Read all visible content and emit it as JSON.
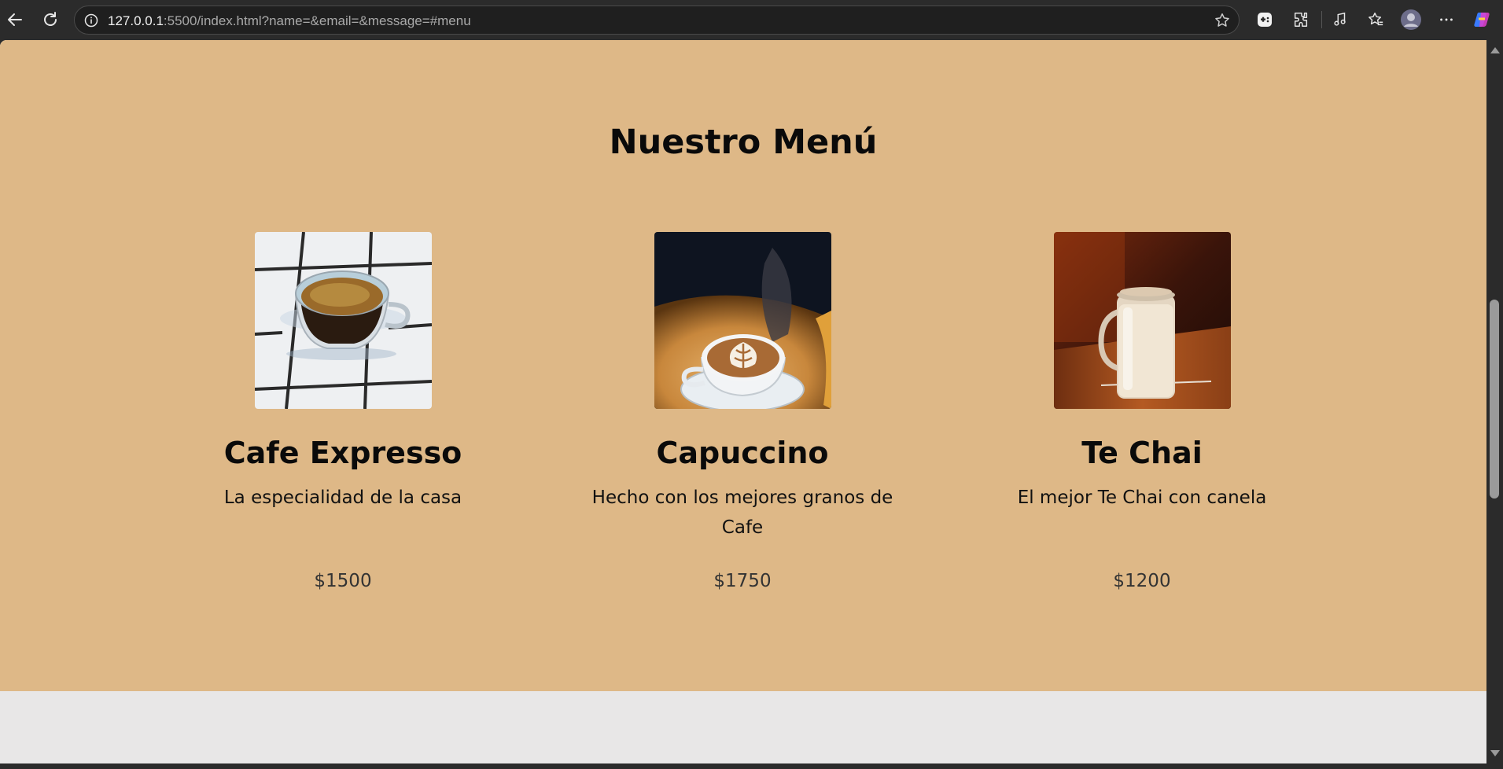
{
  "browser": {
    "url_host": "127.0.0.1",
    "url_rest": ":5500/index.html?name=&email=&message=#menu",
    "icons": {
      "back": "back-arrow-icon",
      "reload": "reload-icon",
      "info": "info-icon",
      "favorite": "star-icon",
      "games": "games-icon",
      "extensions": "extensions-icon",
      "read_aloud": "read-aloud-icon",
      "favorites": "favorites-icon",
      "profile": "profile-avatar",
      "more": "more-icon",
      "copilot": "copilot-icon"
    }
  },
  "menu": {
    "title": "Nuestro Menú",
    "items": [
      {
        "name": "Cafe Expresso",
        "description": "La especialidad de la casa",
        "price": "$1500",
        "image": "espresso-cup-photo"
      },
      {
        "name": "Capuccino",
        "description": "Hecho con los mejores granos de Cafe",
        "price": "$1750",
        "image": "cappuccino-latte-art-photo"
      },
      {
        "name": "Te Chai",
        "description": "El mejor Te Chai con canela",
        "price": "$1200",
        "image": "chai-jar-photo"
      }
    ]
  },
  "colors": {
    "section_background": "#deb887",
    "page_background": "#e8e7e7",
    "browser_chrome": "#2b2b2b"
  }
}
